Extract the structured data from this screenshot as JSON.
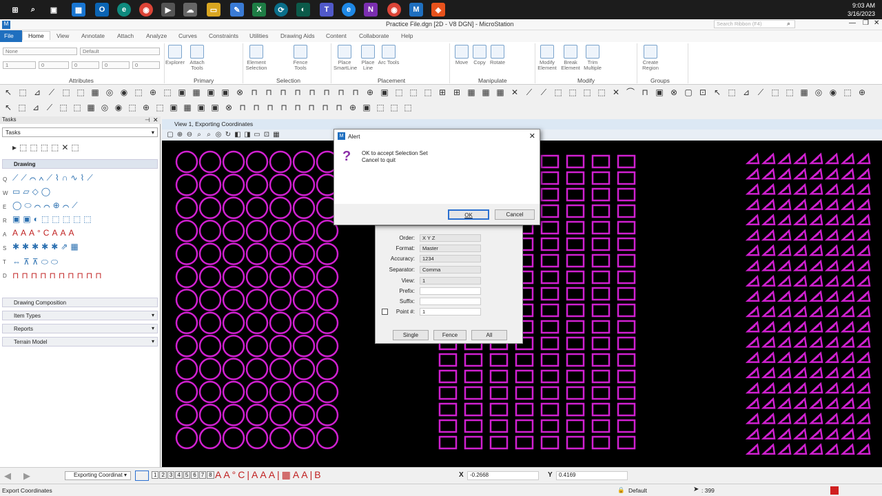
{
  "clock": {
    "time": "9:03 AM",
    "date": "3/16/2023"
  },
  "window": {
    "title": "Practice File.dgn [2D - V8 DGN] - MicroStation",
    "search_placeholder": "Search Ribbon (F4)"
  },
  "ribbon_tabs": [
    "File",
    "Home",
    "View",
    "Annotate",
    "Attach",
    "Analyze",
    "Curves",
    "Constraints",
    "Utilities",
    "Drawing Aids",
    "Content",
    "Collaborate",
    "Help"
  ],
  "ribbon_groups": {
    "attributes": "Attributes",
    "primary": "Primary",
    "selection": "Selection",
    "placement": "Placement",
    "manipulate": "Manipulate",
    "modify": "Modify",
    "groups": "Groups"
  },
  "attributes": {
    "level": "None",
    "style": "Default",
    "color": "1",
    "weight": "0",
    "line": "0",
    "priority": "0",
    "transparency": "0"
  },
  "ribbon_buttons": {
    "explorer": "Explorer",
    "attach_tools": "Attach Tools",
    "element_selection": "Element Selection",
    "fence_tools": "Fence Tools",
    "place_smartline": "Place SmartLine",
    "place_line": "Place Line",
    "arc_tools": "Arc Tools",
    "move": "Move",
    "copy": "Copy",
    "rotate": "Rotate",
    "modify_element": "Modify Element",
    "break_element": "Break Element",
    "trim_multiple": "Trim Multiple",
    "create_region": "Create Region"
  },
  "tasks": {
    "header": "Tasks",
    "selected": "Tasks",
    "drawing": "Drawing",
    "drawing_composition": "Drawing Composition",
    "item_types": "Item Types",
    "reports": "Reports",
    "terrain_model": "Terrain Model",
    "row_letters": [
      "Q",
      "W",
      "E",
      "R",
      "A",
      "S",
      "T",
      "D"
    ]
  },
  "view": {
    "title": "View 1, Exporting Coordinates"
  },
  "alert": {
    "title": "Alert",
    "line1": "OK to accept Selection Set",
    "line2": "Cancel to quit",
    "ok": "OK",
    "cancel": "Cancel"
  },
  "export": {
    "order_label": "Order:",
    "order": "X Y Z",
    "format_label": "Format:",
    "format": "Master",
    "accuracy_label": "Accuracy:",
    "accuracy": "1234",
    "separator_label": "Separator:",
    "separator": "Comma",
    "view_label": "View:",
    "view": "1",
    "prefix_label": "Prefix:",
    "prefix": "",
    "suffix_label": "Suffix:",
    "suffix": "",
    "point_label": "Point #:",
    "point": "1",
    "single": "Single",
    "fence": "Fence",
    "all": "All"
  },
  "bottom": {
    "model": "Exporting Coordinat",
    "views": [
      "1",
      "2",
      "3",
      "4",
      "5",
      "6",
      "7",
      "8"
    ],
    "x_label": "X",
    "x_value": "-0.2668",
    "y_label": "Y",
    "y_value": "0.4169"
  },
  "status": {
    "prompt": "Export Coordinates",
    "level": "Default",
    "count": ": 399"
  },
  "colors": {
    "magenta": "#d020d0",
    "accent": "#1f6fbf"
  }
}
